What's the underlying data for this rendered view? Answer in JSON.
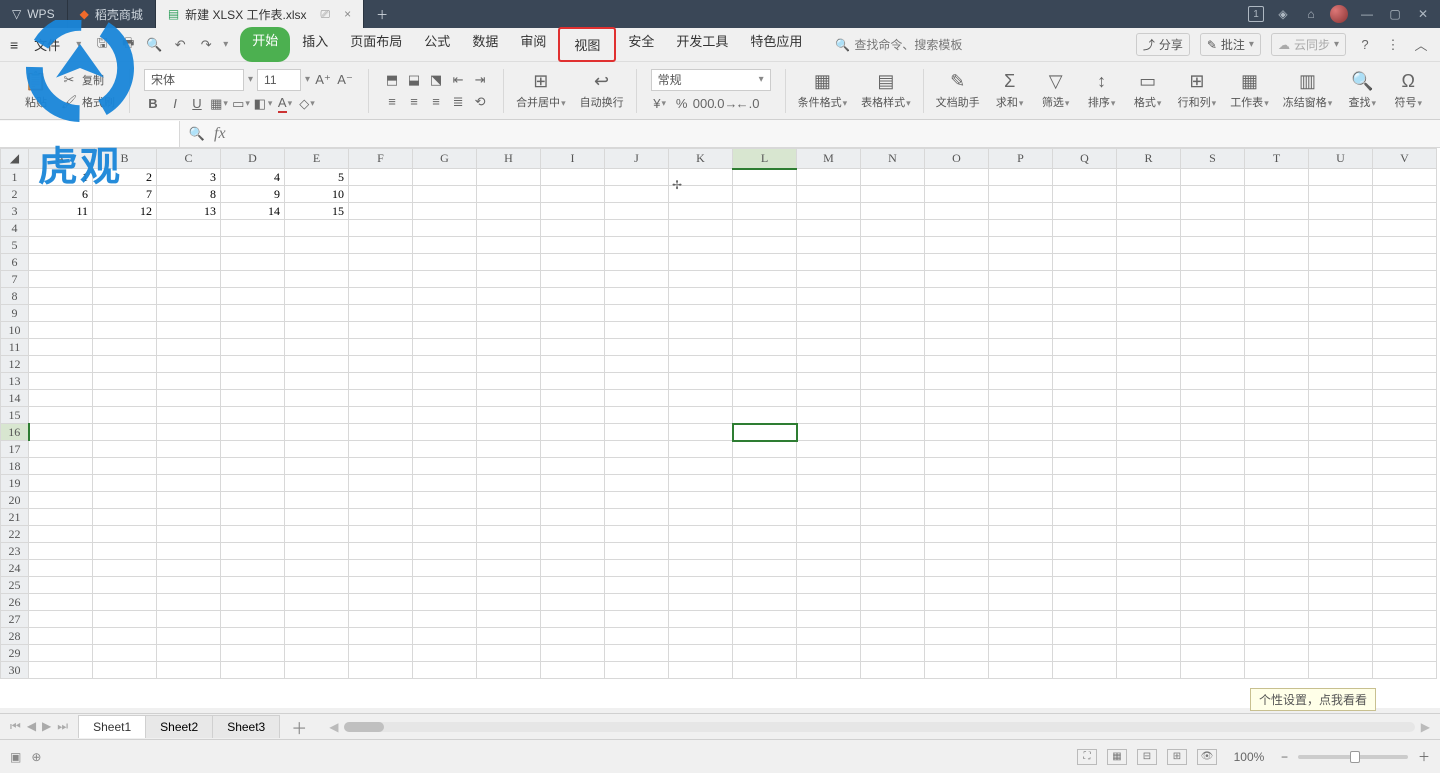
{
  "titlebar": {
    "app": "WPS",
    "tabs": [
      {
        "icon": "flame-icon",
        "label": "稻壳商城"
      },
      {
        "icon": "sheet-icon",
        "label": "新建 XLSX 工作表.xlsx",
        "active": true,
        "device": "⎚",
        "close": "×"
      }
    ],
    "badge": "1"
  },
  "menubar": {
    "file": "文件",
    "items": [
      "开始",
      "插入",
      "页面布局",
      "公式",
      "数据",
      "审阅",
      "视图",
      "安全",
      "开发工具",
      "特色应用"
    ],
    "highlight_index": 6,
    "search_placeholder": "查找命令、搜索模板",
    "share": "分享",
    "comment": "批注",
    "sync": "云同步"
  },
  "ribbon": {
    "paste": "粘贴",
    "copy": "复制",
    "format_painter": "格式刷",
    "font_name": "宋体",
    "font_size": "11",
    "merge_center": "合并居中",
    "wrap_text": "自动换行",
    "number_format": "常规",
    "cond_fmt": "条件格式",
    "table_style": "表格样式",
    "doc_helper": "文档助手",
    "sum": "求和",
    "filter": "筛选",
    "sort": "排序",
    "format": "格式",
    "row_col": "行和列",
    "worksheet": "工作表",
    "freeze": "冻结窗格",
    "find": "查找",
    "symbol": "符号"
  },
  "cellref": {
    "name": "",
    "formula": ""
  },
  "columns": [
    "A",
    "B",
    "C",
    "D",
    "E",
    "F",
    "G",
    "H",
    "I",
    "J",
    "K",
    "L",
    "M",
    "N",
    "O",
    "P",
    "Q",
    "R",
    "S",
    "T",
    "U",
    "V"
  ],
  "row_count": 30,
  "selected": {
    "col": "L",
    "row": 16
  },
  "cells": {
    "r1": [
      "1",
      "2",
      "3",
      "4",
      "5"
    ],
    "r2": [
      "6",
      "7",
      "8",
      "9",
      "10"
    ],
    "r3": [
      "11",
      "12",
      "13",
      "14",
      "15"
    ]
  },
  "sheets": {
    "tabs": [
      "Sheet1",
      "Sheet2",
      "Sheet3"
    ],
    "active": 0
  },
  "tooltip": "个性设置，点我看看",
  "status": {
    "zoom": "100%"
  },
  "watermark": "虎观"
}
